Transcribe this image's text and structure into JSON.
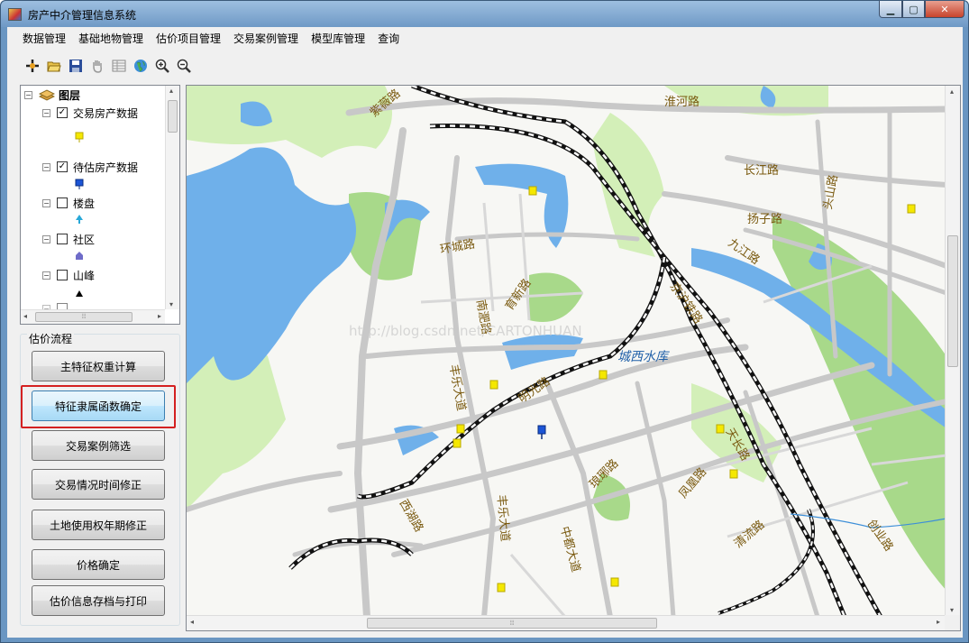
{
  "window": {
    "title": "房产中介管理信息系统"
  },
  "menu": [
    "数据管理",
    "基础地物管理",
    "估价项目管理",
    "交易案例管理",
    "模型库管理",
    "查询"
  ],
  "toolbar": [
    "add-data-icon",
    "open-folder-icon",
    "save-icon",
    "pan-hand-icon",
    "attribute-table-icon",
    "full-extent-globe-icon",
    "zoom-in-icon",
    "zoom-out-icon"
  ],
  "layers": {
    "root": "图层",
    "items": [
      {
        "label": "交易房产数据",
        "checked": true,
        "symbol_color": "#f5e800"
      },
      {
        "label": "待估房产数据",
        "checked": true,
        "symbol_color": "#1c55d6"
      },
      {
        "label": "楼盘",
        "checked": false,
        "symbol_color": "#28a8d8"
      },
      {
        "label": "社区",
        "checked": false,
        "symbol_color": "#6f6cc9"
      },
      {
        "label": "山峰",
        "checked": false,
        "symbol_color": "#000000"
      }
    ]
  },
  "flow": {
    "title": "估价流程",
    "buttons": [
      "主特征权重计算",
      "特征隶属函数确定",
      "交易案例筛选",
      "交易情况时间修正",
      "土地使用权年期修正",
      "价格确定",
      "估价信息存档与打印"
    ],
    "active_index": 1
  },
  "map": {
    "colors": {
      "water": "#6fb0ea",
      "park": "#d3efb8",
      "green": "#a8d98a",
      "road": "#c8c8c8",
      "rail": "#111111"
    },
    "labels": [
      "紫薇路",
      "淮河路",
      "长江路",
      "扬子路",
      "九江路",
      "头山路",
      "环城路",
      "南淝路",
      "育新路",
      "丰乐大道",
      "明光路",
      "城西水库",
      "天长路",
      "凤凰路",
      "琅琊路",
      "西湖路",
      "丰乐大道",
      "中都大道",
      "清流路",
      "创业路",
      "京沪铁路"
    ],
    "watermark": "http://blog.csdn.net/CARTONHUAN"
  },
  "scroll": {
    "left_arrow": "◂",
    "right_arrow": "▸",
    "up_arrow": "▴",
    "down_arrow": "▾",
    "grip": "⦙⦙⦙"
  }
}
